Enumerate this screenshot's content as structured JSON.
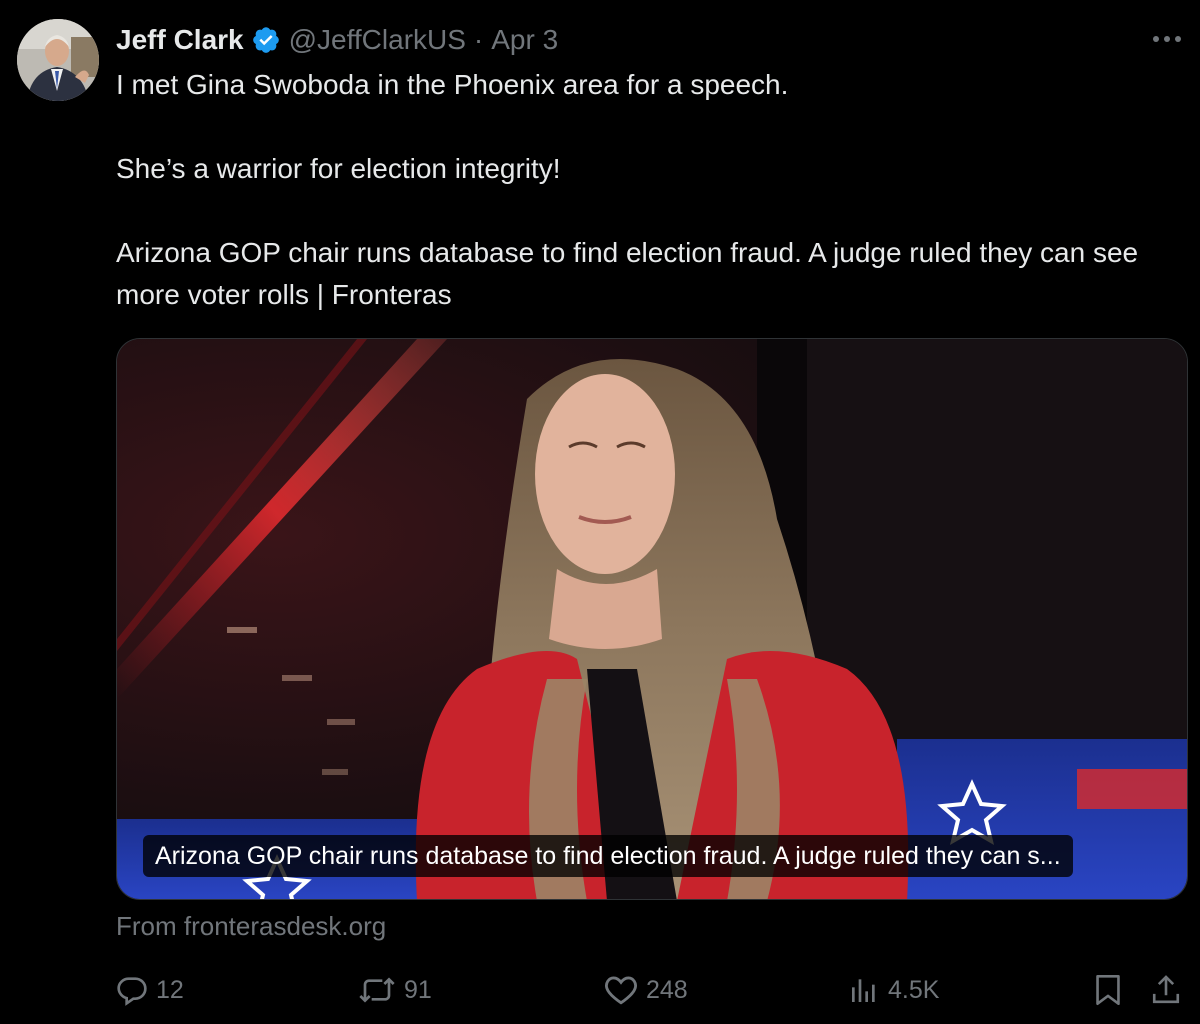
{
  "tweet": {
    "author": {
      "display_name": "Jeff Clark",
      "handle": "@JeffClarkUS",
      "separator": "·",
      "date": "Apr 3",
      "verified_icon": "verified-badge-icon"
    },
    "text": {
      "line1": "I met Gina Swoboda in the Phoenix area for a speech.",
      "line2": "She’s a warrior for election integrity!",
      "line3": "Arizona GOP chair runs database to find election fraud. A judge ruled they can see more voter rolls | Fronteras"
    },
    "card": {
      "caption": "Arizona GOP chair runs database to find election fraud. A judge ruled they can s...",
      "source": "From fronterasdesk.org"
    },
    "actions": {
      "replies": "12",
      "reposts": "91",
      "likes": "248",
      "views": "4.5K"
    },
    "icons": [
      "more-icon",
      "reply-icon",
      "repost-icon",
      "like-icon",
      "views-icon",
      "bookmark-icon",
      "share-icon"
    ]
  },
  "colors": {
    "background": "#000000",
    "text": "#e7e9ea",
    "secondary": "#71767b",
    "verified": "#1d9bf0",
    "jacket": "#c8232c"
  }
}
